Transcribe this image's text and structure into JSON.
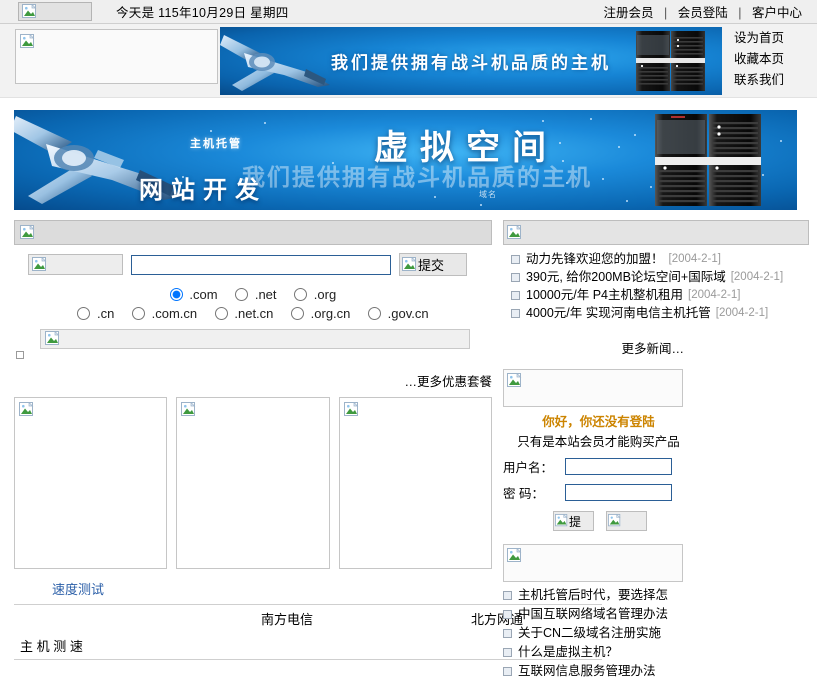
{
  "topbar": {
    "date_text": "今天是 115年10月29日 星期四",
    "links": [
      {
        "label": "注册会员"
      },
      {
        "label": "会员登陆"
      },
      {
        "label": "客户中心"
      }
    ],
    "separator": "|"
  },
  "header": {
    "mini_banner_text": "我们提供拥有战斗机品质的主机",
    "quick_links": [
      {
        "label": "设为首页"
      },
      {
        "label": "收藏本页"
      },
      {
        "label": "联系我们"
      }
    ]
  },
  "hero": {
    "tag": "主机托管",
    "title": "虚拟空间",
    "slogan": "我们提供拥有战斗机品质的主机",
    "subtitle": "网站开发",
    "small_text": "域名"
  },
  "domain_search": {
    "input_value": "",
    "input_placeholder": "",
    "submit_label": "提交",
    "tld_row1": [
      {
        "label": ".com",
        "checked": true
      },
      {
        "label": ".net",
        "checked": false
      },
      {
        "label": ".org",
        "checked": false
      }
    ],
    "tld_row2": [
      {
        "label": ".cn",
        "checked": false
      },
      {
        "label": ".com.cn",
        "checked": false
      },
      {
        "label": ".net.cn",
        "checked": false
      },
      {
        "label": ".org.cn",
        "checked": false
      },
      {
        "label": ".gov.cn",
        "checked": false
      }
    ]
  },
  "news": {
    "items": [
      {
        "title": "动力先锋欢迎您的加盟！",
        "date": "[2004-2-1]"
      },
      {
        "title": "390元, 给你200MB论坛空间+国际域",
        "date": "[2004-2-1]"
      },
      {
        "title": "10000元/年  P4主机整机租用",
        "date": "[2004-2-1]"
      },
      {
        "title": "4000元/年  实现河南电信主机托管",
        "date": "[2004-2-1]"
      }
    ],
    "more_label": "更多新闻…"
  },
  "packages": {
    "more_label": "…更多优惠套餐",
    "cards": [
      {
        "name": "package-card-1"
      },
      {
        "name": "package-card-2"
      },
      {
        "name": "package-card-3"
      }
    ]
  },
  "speedtest": {
    "title": "速度测试",
    "columns": [
      "",
      "南方电信",
      "北方网通"
    ],
    "rows": [
      {
        "label": "主 机 测 速",
        "south": "",
        "north": ""
      }
    ]
  },
  "login": {
    "greeting": "你好，你还没有登陆",
    "note": "只有是本站会员才能购买产品",
    "username_label": "用户名：",
    "password_label": "密    码：",
    "username_value": "",
    "password_value": "",
    "submit_label": "提",
    "reset_label": ""
  },
  "help": {
    "items": [
      {
        "label": "主机托管后时代，要选择怎"
      },
      {
        "label": "中国互联网络域名管理办法"
      },
      {
        "label": "关于CN二级域名注册实施"
      },
      {
        "label": "什么是虚拟主机？"
      },
      {
        "label": "互联网信息服务管理办法"
      }
    ]
  },
  "colors": {
    "accent_blue": "#1b8ada",
    "deep_blue": "#054b8d",
    "link_blue": "#2b5fa8",
    "warn_orange": "#cc8400",
    "panel_gray": "#dcdcdc",
    "page_bg": "#ffffff"
  }
}
